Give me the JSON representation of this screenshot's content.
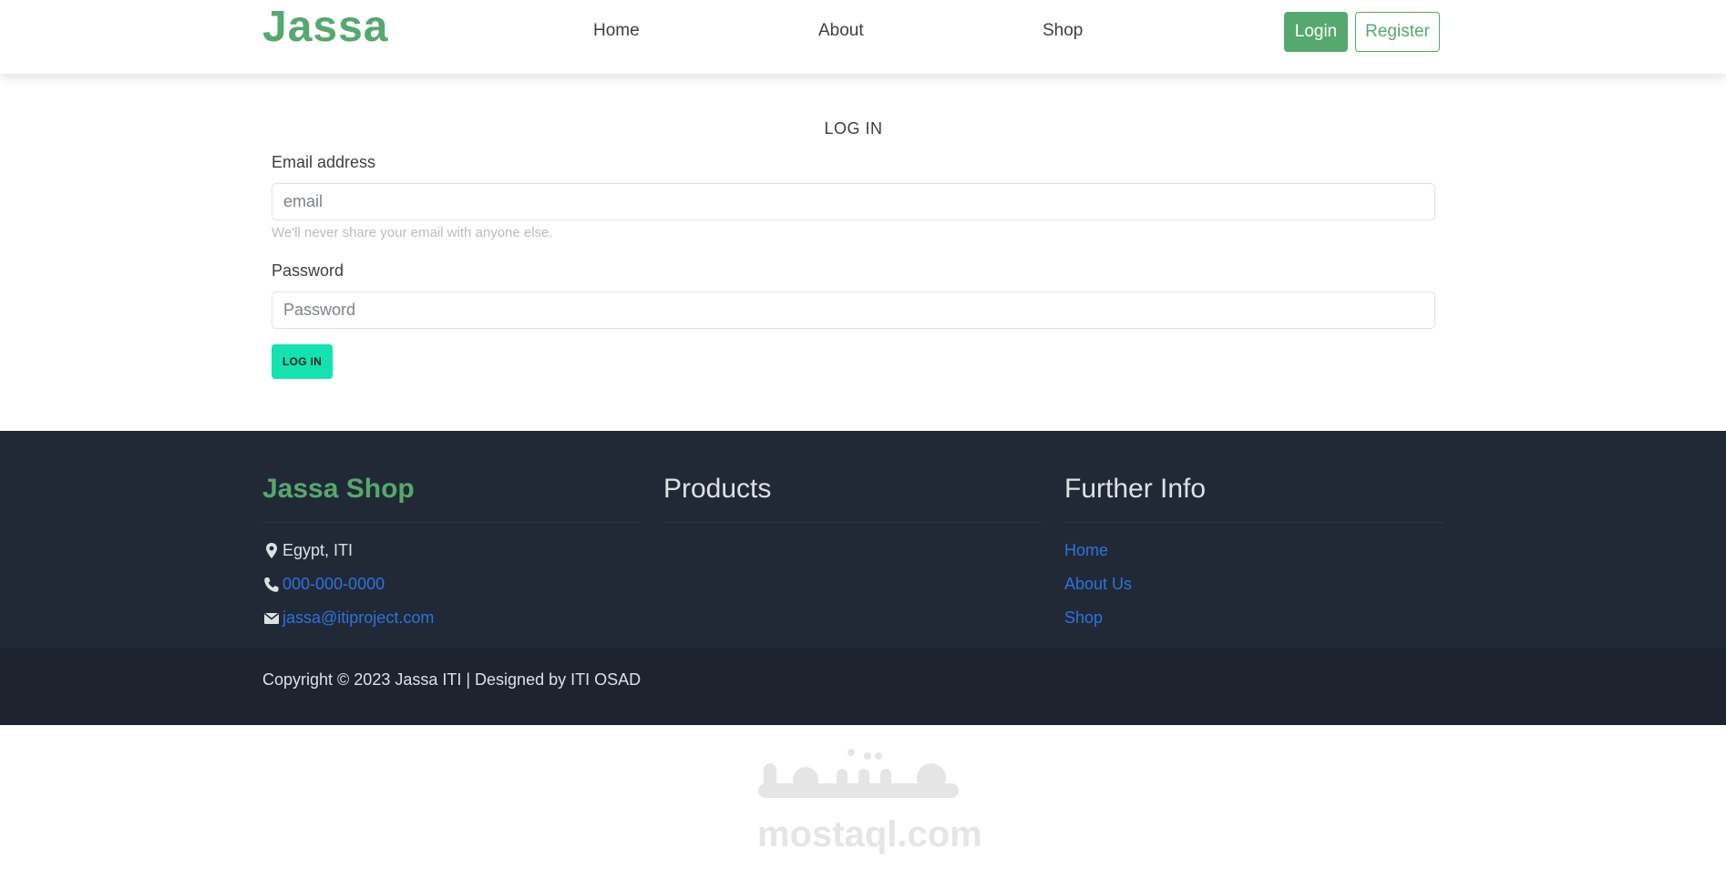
{
  "navbar": {
    "brand": "Jassa",
    "links": [
      "Home",
      "About",
      "Shop"
    ],
    "login_label": "Login",
    "register_label": "Register"
  },
  "login_form": {
    "title": "LOG IN",
    "email_label": "Email address",
    "email_placeholder": "email",
    "email_help": "We'll never share your email with anyone else.",
    "password_label": "Password",
    "password_placeholder": "Password",
    "submit_label": "LOG IN"
  },
  "footer": {
    "col1": {
      "heading": "Jassa Shop",
      "address_icon": "map-marker-icon",
      "address": "Egypt, ITI",
      "phone_icon": "phone-icon",
      "phone": "000-000-0000",
      "email_icon": "envelope-icon",
      "email": "jassa@itiproject.com"
    },
    "col2": {
      "heading": "Products"
    },
    "col3": {
      "heading": "Further Info",
      "links": [
        "Home",
        "About Us",
        "Shop"
      ]
    },
    "copyright": "Copyright © 2023 Jassa ITI | Designed by ITI OSAD"
  },
  "watermark": {
    "text": "mostaql.com"
  },
  "colors": {
    "brand_green": "#56a86e",
    "submit_teal": "#13e3b0",
    "footer_bg": "#212936",
    "copyright_bg": "#1d2430",
    "link_blue": "#2d73dc"
  }
}
